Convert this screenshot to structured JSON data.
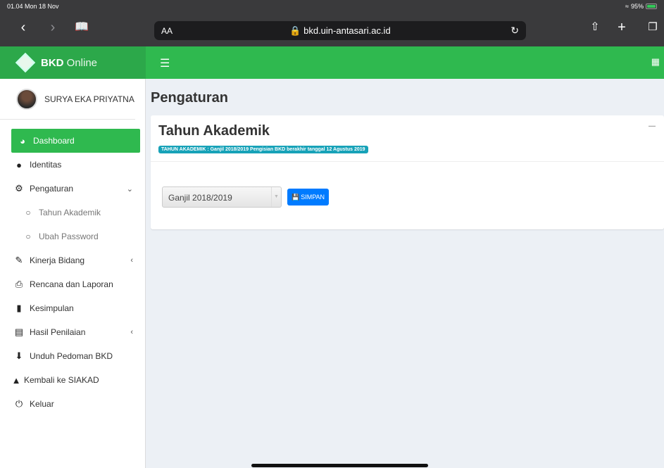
{
  "status_bar": {
    "time_date": "01.04  Mon 18 Nov",
    "battery": "95%"
  },
  "browser": {
    "text_size": "AA",
    "url": "bkd.uin-antasari.ac.id"
  },
  "app": {
    "brand_bold": "BKD",
    "brand_light": " Online"
  },
  "user": {
    "name": "SURYA EKA PRIYATNA"
  },
  "sidebar": {
    "items": [
      {
        "label": "Dashboard",
        "icon": "dashboard-icon"
      },
      {
        "label": "Identitas",
        "icon": "user-icon"
      },
      {
        "label": "Pengaturan",
        "icon": "gear-icon"
      },
      {
        "label": "Tahun Akademik",
        "icon": "circle-icon"
      },
      {
        "label": "Ubah Password",
        "icon": "circle-icon"
      },
      {
        "label": "Kinerja Bidang",
        "icon": "edit-icon"
      },
      {
        "label": "Rencana dan Laporan",
        "icon": "print-icon"
      },
      {
        "label": "Kesimpulan",
        "icon": "book-icon"
      },
      {
        "label": "Hasil Penilaian",
        "icon": "document-icon"
      },
      {
        "label": "Unduh Pedoman BKD",
        "icon": "download-icon"
      },
      {
        "label": "Kembali ke SIAKAD",
        "icon": "graduation-cap-icon"
      },
      {
        "label": "Keluar",
        "icon": "power-icon"
      }
    ]
  },
  "main": {
    "page_title": "Pengaturan",
    "box_title": "Tahun Akademik",
    "badge": "TAHUN AKADEMIK : Ganjil 2018/2019 Pengisian BKD berakhir tanggal 12 Agustus 2019",
    "select_value": "Ganjil 2018/2019",
    "save_label": "SIMPAN"
  },
  "colors": {
    "header_green": "#2fb94f",
    "brand_green": "#2ca84a",
    "badge_teal": "#17a2b8",
    "button_blue": "#007bff"
  }
}
